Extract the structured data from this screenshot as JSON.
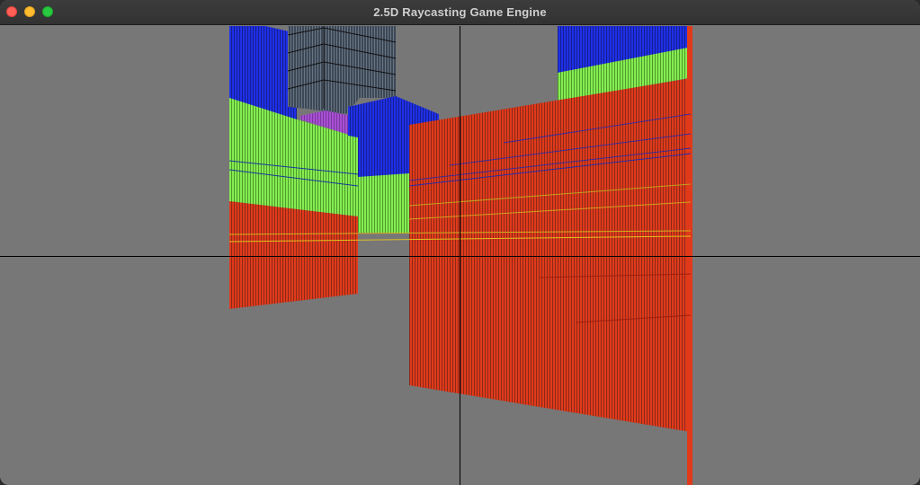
{
  "window": {
    "title": "2.5D Raycasting Game Engine"
  },
  "colors": {
    "background": "#777777",
    "wall_red": "#e03a1a",
    "wall_green": "#7fe84a",
    "wall_blue": "#1f2fe6",
    "wall_purple": "#a64fd0",
    "wall_slate": "#3a4654",
    "crosshair": "#000000"
  },
  "scene": {
    "walls": [
      {
        "name": "far-blue-wall-left",
        "color": "wall_blue"
      },
      {
        "name": "slate-tower",
        "color": "wall_slate"
      },
      {
        "name": "green-wall-left",
        "color": "wall_green"
      },
      {
        "name": "purple-block",
        "color": "wall_purple"
      },
      {
        "name": "blue-pillar-center",
        "color": "wall_blue"
      },
      {
        "name": "green-block-center",
        "color": "wall_green"
      },
      {
        "name": "red-wall-left",
        "color": "wall_red"
      },
      {
        "name": "far-blue-wall-right",
        "color": "wall_blue"
      },
      {
        "name": "green-wall-right",
        "color": "wall_green"
      },
      {
        "name": "red-wall-main",
        "color": "wall_red"
      },
      {
        "name": "red-edge-column",
        "color": "wall_red"
      }
    ]
  }
}
